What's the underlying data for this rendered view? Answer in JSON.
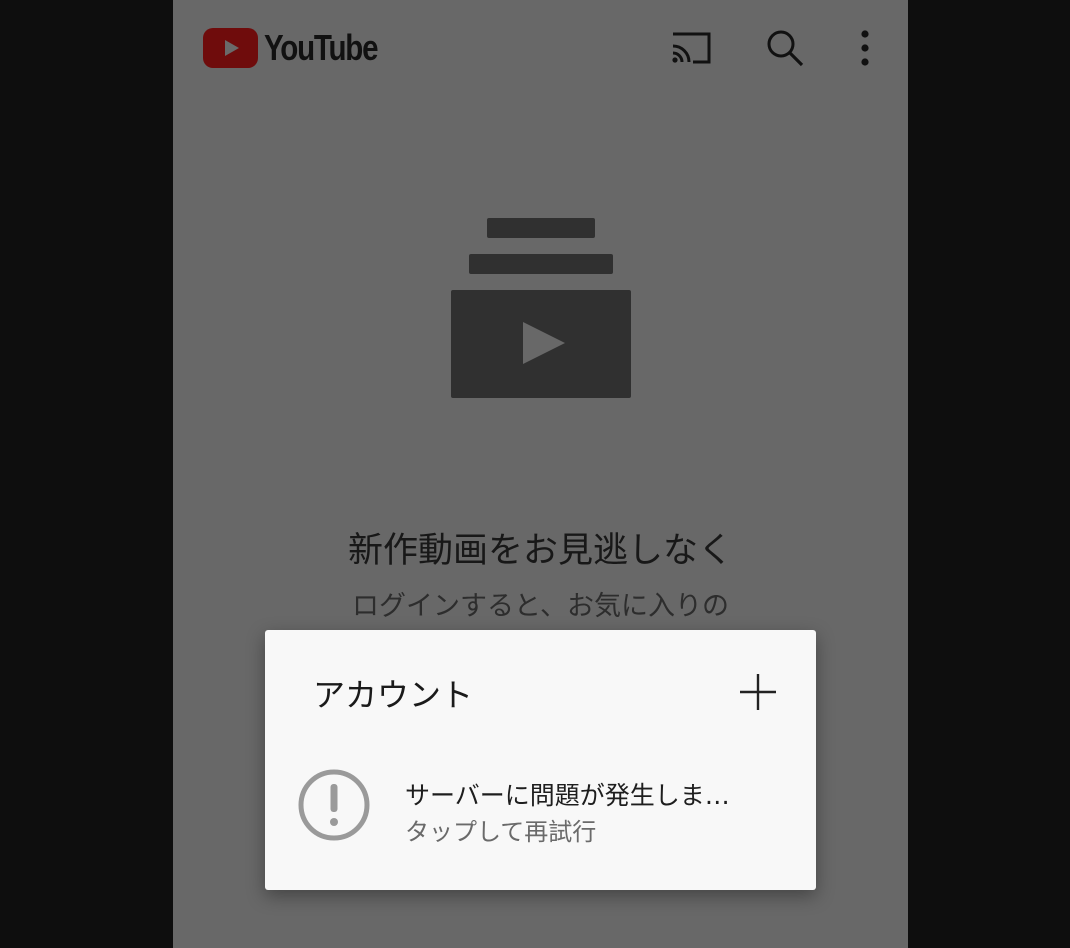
{
  "app": {
    "logo_text": "YouTube",
    "brand_color": "#6f0c0c"
  },
  "appbar": {
    "icons": [
      "cast-icon",
      "search-icon",
      "more-vert-icon"
    ]
  },
  "empty_state": {
    "icon": "subscriptions-icon",
    "headline": "新作動画をお見逃しなく",
    "subline": "ログインすると、お気に入りの"
  },
  "account_dialog": {
    "title": "アカウント",
    "add_icon": "plus-icon",
    "error": {
      "icon": "alert-circle-icon",
      "title": "サーバーに問題が発生しま…",
      "subtitle": "タップして再試行"
    }
  }
}
